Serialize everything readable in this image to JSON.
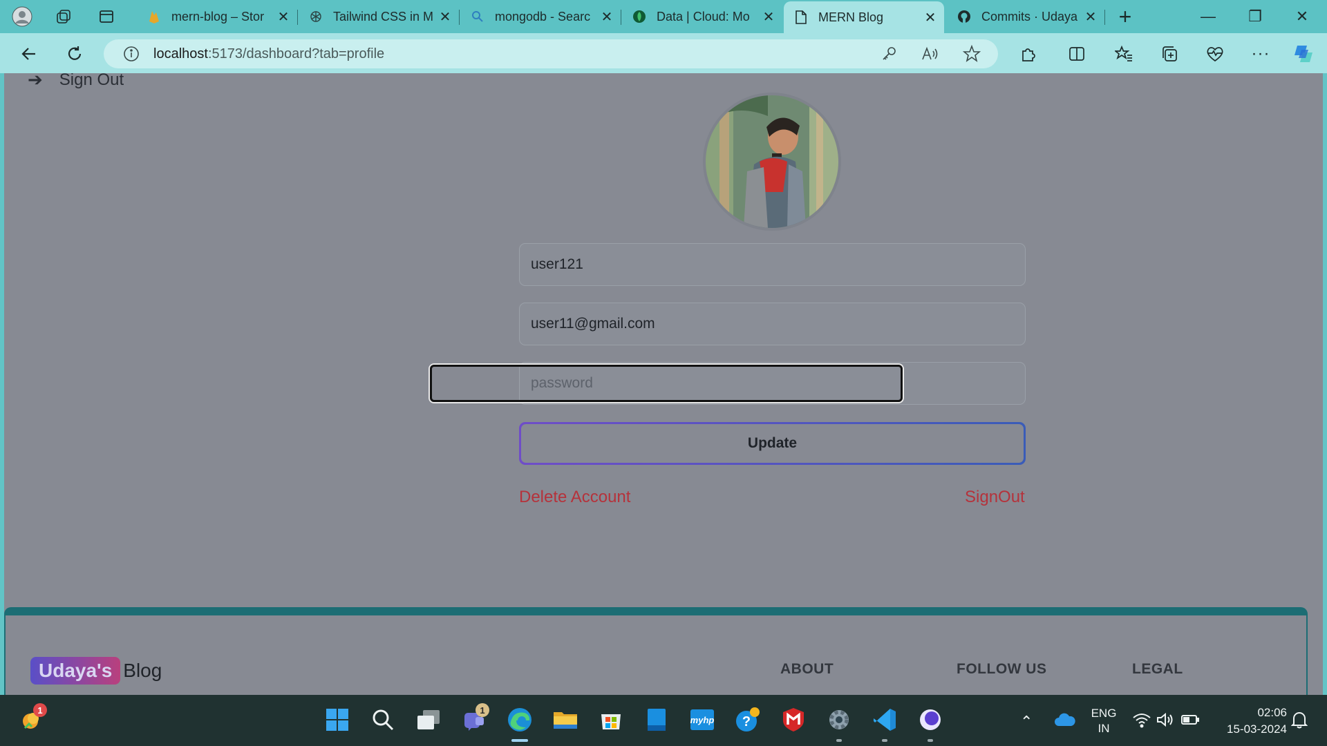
{
  "browser": {
    "tabs": [
      {
        "title": "mern-blog – Stor",
        "icon": "firebase-icon",
        "active": false
      },
      {
        "title": "Tailwind CSS in M",
        "icon": "chatgpt-icon",
        "active": false
      },
      {
        "title": "mongodb - Searc",
        "icon": "search-icon",
        "active": false
      },
      {
        "title": "Data | Cloud: Mo",
        "icon": "mongodb-leaf-icon",
        "active": false
      },
      {
        "title": "MERN Blog",
        "icon": "page-icon",
        "active": true
      },
      {
        "title": "Commits · Udaya",
        "icon": "github-icon",
        "active": false
      }
    ],
    "close_glyph": "✕",
    "new_tab_glyph": "+",
    "url_host": "localhost",
    "url_rest": ":5173/dashboard?tab=profile",
    "window_controls": {
      "minimize": "—",
      "restore": "❐",
      "close": "✕"
    },
    "accent": "#5cc2c4"
  },
  "page": {
    "sidebar_signout": "Sign Out",
    "username": "user121",
    "email": "user11@gmail.com",
    "password_placeholder": "password",
    "update_label": "Update",
    "delete_label": "Delete Account",
    "signout_label": "SignOut",
    "danger_color": "#b5323b",
    "footer": {
      "brand_chip": "Udaya's",
      "brand_rest": "Blog",
      "headings": [
        "ABOUT",
        "FOLLOW US",
        "LEGAL"
      ]
    }
  },
  "taskbar": {
    "widget_badge": "1",
    "teams_badge": "1",
    "lang_top": "ENG",
    "lang_bottom": "IN",
    "time": "02:06",
    "date": "15-03-2024"
  }
}
